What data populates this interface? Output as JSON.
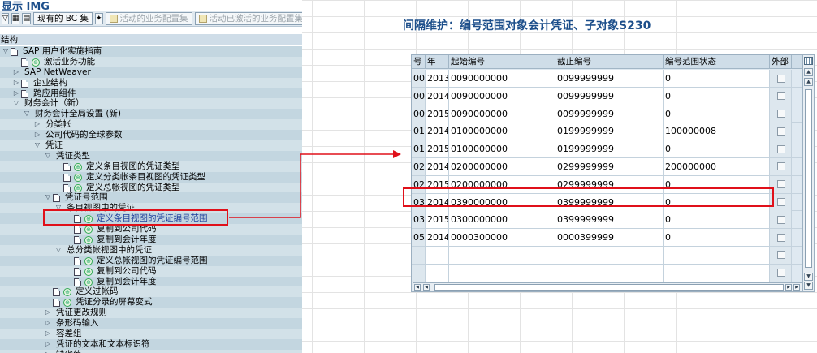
{
  "left": {
    "title": "显示 IMG",
    "toolbar": {
      "existing_bc": "现有的 BC 集",
      "active_config": "活动的业务配置集",
      "activated_config": "活动已激活的业务配置集"
    },
    "tree_header": "结构",
    "tree": [
      {
        "label": "SAP 用户化实施指南",
        "toggle": "▽",
        "icons": [
          "doc"
        ],
        "indent": 0
      },
      {
        "label": "激活业务功能",
        "toggle": "",
        "icons": [
          "doc",
          "clock"
        ],
        "indent": 1
      },
      {
        "label": "SAP NetWeaver",
        "toggle": "▷",
        "icons": [],
        "indent": 1
      },
      {
        "label": "企业结构",
        "toggle": "▷",
        "icons": [
          "doc"
        ],
        "indent": 1
      },
      {
        "label": "跨应用组件",
        "toggle": "▷",
        "icons": [
          "doc"
        ],
        "indent": 1
      },
      {
        "label": "财务会计（新）",
        "toggle": "▽",
        "icons": [],
        "indent": 1
      },
      {
        "label": "财务会计全局设置 (新)",
        "toggle": "▽",
        "icons": [],
        "indent": 2
      },
      {
        "label": "分类帐",
        "toggle": "▷",
        "icons": [],
        "indent": 3
      },
      {
        "label": "公司代码的全球参数",
        "toggle": "▷",
        "icons": [],
        "indent": 3
      },
      {
        "label": "凭证",
        "toggle": "▽",
        "icons": [],
        "indent": 3
      },
      {
        "label": "凭证类型",
        "toggle": "▽",
        "icons": [],
        "indent": 4
      },
      {
        "label": "定义条目视图的凭证类型",
        "toggle": "",
        "icons": [
          "doc",
          "clock"
        ],
        "indent": 5
      },
      {
        "label": "定义分类帐条目视图的凭证类型",
        "toggle": "",
        "icons": [
          "doc",
          "clock"
        ],
        "indent": 5
      },
      {
        "label": "定义总帐视图的凭证类型",
        "toggle": "",
        "icons": [
          "doc",
          "clock"
        ],
        "indent": 5
      },
      {
        "label": "凭证号范围",
        "toggle": "▽",
        "icons": [
          "doc"
        ],
        "indent": 4
      },
      {
        "label": "条目视图中的凭证",
        "toggle": "▽",
        "icons": [],
        "indent": 5
      },
      {
        "label": "定义条目视图的凭证编号范围",
        "toggle": "",
        "icons": [
          "doc",
          "clock"
        ],
        "indent": 6,
        "selected": true
      },
      {
        "label": "复制到公司代码",
        "toggle": "",
        "icons": [
          "doc",
          "clock"
        ],
        "indent": 6
      },
      {
        "label": "复制到会计年度",
        "toggle": "",
        "icons": [
          "doc",
          "clock"
        ],
        "indent": 6
      },
      {
        "label": "总分类帐视图中的凭证",
        "toggle": "▽",
        "icons": [],
        "indent": 5
      },
      {
        "label": "定义总帐视图的凭证编号范围",
        "toggle": "",
        "icons": [
          "doc",
          "clock"
        ],
        "indent": 6
      },
      {
        "label": "复制到公司代码",
        "toggle": "",
        "icons": [
          "doc",
          "clock"
        ],
        "indent": 6
      },
      {
        "label": "复制到会计年度",
        "toggle": "",
        "icons": [
          "doc",
          "clock"
        ],
        "indent": 6
      },
      {
        "label": "定义过帐码",
        "toggle": "",
        "icons": [
          "doc",
          "clock"
        ],
        "indent": 4
      },
      {
        "label": "凭证分录的屏幕变式",
        "toggle": "",
        "icons": [
          "doc",
          "clock"
        ],
        "indent": 4
      },
      {
        "label": "凭证更改规则",
        "toggle": "▷",
        "icons": [],
        "indent": 4
      },
      {
        "label": "条形码输入",
        "toggle": "▷",
        "icons": [],
        "indent": 4
      },
      {
        "label": "容差组",
        "toggle": "▷",
        "icons": [],
        "indent": 4
      },
      {
        "label": "凭证的文本和文本标识符",
        "toggle": "▷",
        "icons": [],
        "indent": 4
      },
      {
        "label": "缺省值",
        "toggle": "▷",
        "icons": [],
        "indent": 4
      }
    ]
  },
  "right": {
    "title": "间隔维护：编号范围对象会计凭证、子对象S230",
    "columns": [
      "号",
      "年",
      "起始编号",
      "截止编号",
      "编号范围状态",
      "外部"
    ],
    "rows": [
      [
        "00",
        "2013",
        "0090000000",
        "0099999999",
        "0"
      ],
      [
        "00",
        "2014",
        "0090000000",
        "0099999999",
        "0"
      ],
      [
        "00",
        "2015",
        "0090000000",
        "0099999999",
        "0"
      ],
      [
        "01",
        "2014",
        "0100000000",
        "0199999999",
        "100000008"
      ],
      [
        "01",
        "2015",
        "0100000000",
        "0199999999",
        "0"
      ],
      [
        "02",
        "2014",
        "0200000000",
        "0299999999",
        "200000000"
      ],
      [
        "02",
        "2015",
        "0200000000",
        "0299999999",
        "0"
      ],
      [
        "03",
        "2014",
        "0390000000",
        "0399999999",
        "0"
      ],
      [
        "03",
        "2015",
        "0300000000",
        "0399999999",
        "0"
      ],
      [
        "05",
        "2014",
        "0000300000",
        "0000399999",
        "0"
      ],
      [
        "",
        "",
        "",
        "",
        ""
      ],
      [
        "",
        "",
        "",
        "",
        ""
      ]
    ]
  },
  "colors": {
    "highlight": "#e0101a",
    "tree_bg": "#c3d6e0",
    "title_blue": "#1d4f8b"
  }
}
